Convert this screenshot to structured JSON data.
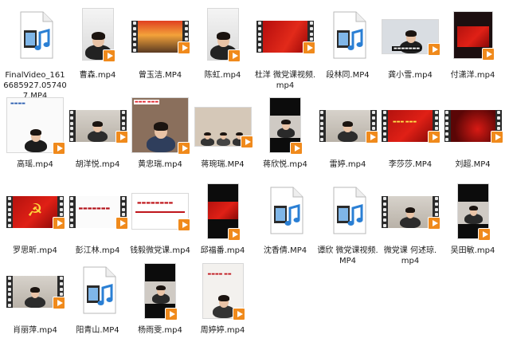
{
  "colors": {
    "play_badge": "#f08a1c",
    "film": "#2b2b2b",
    "text": "#1a1a1a",
    "icon_blue": "#2a7fd4"
  },
  "files": [
    {
      "name": "FinalVideo_1616685927.057407.MP4",
      "lines": [
        "FinalVideo_161",
        "6685927.05740",
        "7.MP4"
      ],
      "thumb": "media-file-icon"
    },
    {
      "name": "曹森.mp4",
      "lines": [
        "曹森.mp4"
      ],
      "thumb": "portrait-video"
    },
    {
      "name": "曾玉洁.MP4",
      "lines": [
        "曾玉洁.MP4"
      ],
      "thumb": "film-great-wall"
    },
    {
      "name": "陈虹.mp4",
      "lines": [
        "陈虹.mp4"
      ],
      "thumb": "portrait-video"
    },
    {
      "name": "杜洋 微党课视频.mp4",
      "lines": [
        "杜洋 微党课视频.",
        "mp4"
      ],
      "thumb": "film-red-flag"
    },
    {
      "name": "段林同.MP4",
      "lines": [
        "段林同.MP4"
      ],
      "thumb": "media-file-icon"
    },
    {
      "name": "龚小雪.mp4",
      "lines": [
        "龚小雪.mp4"
      ],
      "thumb": "landscape-video"
    },
    {
      "name": "付潇洋.mp4",
      "lines": [
        "付潇洋.mp4"
      ],
      "thumb": "portrait-dark-red"
    },
    {
      "name": "高瑶.mp4",
      "lines": [
        "高瑶.mp4"
      ],
      "thumb": "landscape-white"
    },
    {
      "name": "胡洋悦.mp4",
      "lines": [
        "胡洋悦.mp4"
      ],
      "thumb": "film-person"
    },
    {
      "name": "黄忠瑞.mp4",
      "lines": [
        "黄忠瑞.mp4"
      ],
      "thumb": "landscape-person"
    },
    {
      "name": "蒋琬瑞.MP4",
      "lines": [
        "蒋琬瑞.MP4"
      ],
      "thumb": "landscape-group"
    },
    {
      "name": "蒋欣悦.mp4",
      "lines": [
        "蒋欣悦.mp4"
      ],
      "thumb": "portrait-black"
    },
    {
      "name": "雷婷.mp4",
      "lines": [
        "雷婷.mp4"
      ],
      "thumb": "film-person"
    },
    {
      "name": "李莎莎.MP4",
      "lines": [
        "李莎莎.MP4"
      ],
      "thumb": "film-red-banner"
    },
    {
      "name": "刘超.MP4",
      "lines": [
        "刘超.MP4"
      ],
      "thumb": "film-red-dark"
    },
    {
      "name": "罗思昕.mp4",
      "lines": [
        "罗思昕.mp4"
      ],
      "thumb": "film-party-emblem"
    },
    {
      "name": "彭江林.mp4",
      "lines": [
        "彭江林.mp4"
      ],
      "thumb": "film-white-slide"
    },
    {
      "name": "钱毅微党课.mp4",
      "lines": [
        "钱毅微党课.mp4"
      ],
      "thumb": "landscape-slide"
    },
    {
      "name": "邱福番.mp4",
      "lines": [
        "邱福番.mp4"
      ],
      "thumb": "portrait-black-red"
    },
    {
      "name": "沈香倩.MP4",
      "lines": [
        "沈香倩.MP4"
      ],
      "thumb": "media-file-icon"
    },
    {
      "name": "谭欣 微党课视频.MP4",
      "lines": [
        "谭欣 微党课视频.",
        "MP4"
      ],
      "thumb": "media-file-icon"
    },
    {
      "name": "微党课 何述琼.mp4",
      "lines": [
        "微党课 何述琼.",
        "mp4"
      ],
      "thumb": "film-person"
    },
    {
      "name": "吴田敏.mp4",
      "lines": [
        "吴田敏.mp4"
      ],
      "thumb": "portrait-black"
    },
    {
      "name": "肖丽萍.mp4",
      "lines": [
        "肖丽萍.mp4"
      ],
      "thumb": "film-person"
    },
    {
      "name": "阳青山.MP4",
      "lines": [
        "阳青山.MP4"
      ],
      "thumb": "media-file-icon"
    },
    {
      "name": "杨雨雯.mp4",
      "lines": [
        "杨雨雯.mp4"
      ],
      "thumb": "portrait-black"
    },
    {
      "name": "周婷婷.mp4",
      "lines": [
        "周婷婷.mp4"
      ],
      "thumb": "portrait-white"
    }
  ]
}
